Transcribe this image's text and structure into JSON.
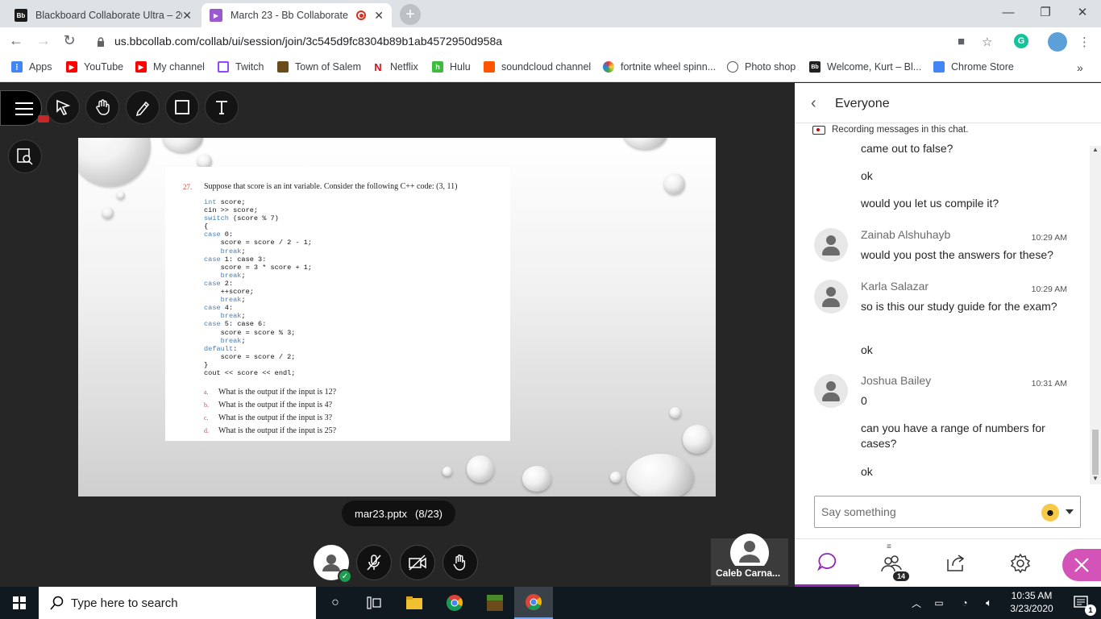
{
  "browser": {
    "tabs": [
      {
        "title": "Blackboard Collaborate Ultra – 20",
        "favicon": "Bb"
      },
      {
        "title": "March 23 - Bb Collaborate",
        "favicon": "play"
      }
    ],
    "url": "us.bbcollab.com/collab/ui/session/join/3c545d9fc8304b89b1ab4572950d958a",
    "bookmarks": [
      {
        "label": "Apps",
        "color": "#4285f4"
      },
      {
        "label": "YouTube",
        "color": "#ff0000"
      },
      {
        "label": "My channel",
        "color": "#ff0000"
      },
      {
        "label": "Twitch",
        "color": "#9146ff"
      },
      {
        "label": "Town of Salem",
        "color": "#6b4b1a"
      },
      {
        "label": "Netflix",
        "color": "#e50914"
      },
      {
        "label": "Hulu",
        "color": "#3dbb3d"
      },
      {
        "label": "soundcloud channel",
        "color": "#ff5500"
      },
      {
        "label": "fortnite wheel spinn...",
        "color": "#e5a50a"
      },
      {
        "label": "Photo shop",
        "color": "#555555"
      },
      {
        "label": "Welcome, Kurt – Bl...",
        "color": "#222222"
      },
      {
        "label": "Chrome Store",
        "color": "#4285f4"
      }
    ]
  },
  "slide": {
    "question_number": "27.",
    "question_text": "Suppose that score is an int variable. Consider the following C++ code: (3, 11)",
    "code_lines": [
      "int score;",
      "cin >> score;",
      "switch (score % 7)",
      "{",
      "case 0:",
      "    score = score / 2 - 1;",
      "    break;",
      "case 1: case 3:",
      "    score = 3 * score + 1;",
      "    break;",
      "case 2:",
      "    ++score;",
      "    break;",
      "case 4:",
      "    break;",
      "case 5: case 6:",
      "    score = score % 3;",
      "    break;",
      "default:",
      "    score = score / 2;",
      "}",
      "cout << score << endl;"
    ],
    "answers": [
      {
        "letter": "a.",
        "text": "What is the output if the input is 12?"
      },
      {
        "letter": "b.",
        "text": "What is the output if the input is 4?"
      },
      {
        "letter": "c.",
        "text": "What is the output if the input is 3?"
      },
      {
        "letter": "d.",
        "text": "What is the output if the input is 25?"
      }
    ],
    "stray_mark": ","
  },
  "file_label": "mar23.pptx",
  "page_counter": "(8/23)",
  "participant_name": "Caleb Carna...",
  "chat": {
    "header": "Everyone",
    "recording_note": "Recording messages in this chat.",
    "messages": [
      {
        "text": "came out to false?"
      },
      {
        "text": "ok"
      },
      {
        "text": "would you let us compile it?"
      },
      {
        "author": "Zainab Alshuhayb",
        "time": "10:29 AM",
        "text": "would you post the answers for these?"
      },
      {
        "author": "Karla Salazar",
        "time": "10:29 AM",
        "text": "so is this our study guide for the exam?"
      },
      {
        "text": "ok"
      },
      {
        "author": "Joshua Bailey",
        "time": "10:31 AM",
        "text": "0"
      },
      {
        "text": "can you have a range of numbers for cases?"
      },
      {
        "text": "ok"
      }
    ],
    "input_placeholder": "Say something",
    "attendee_count": "14"
  },
  "taskbar": {
    "search_placeholder": "Type here to search",
    "time": "10:35 AM",
    "date": "3/23/2020",
    "notification_count": "1"
  }
}
